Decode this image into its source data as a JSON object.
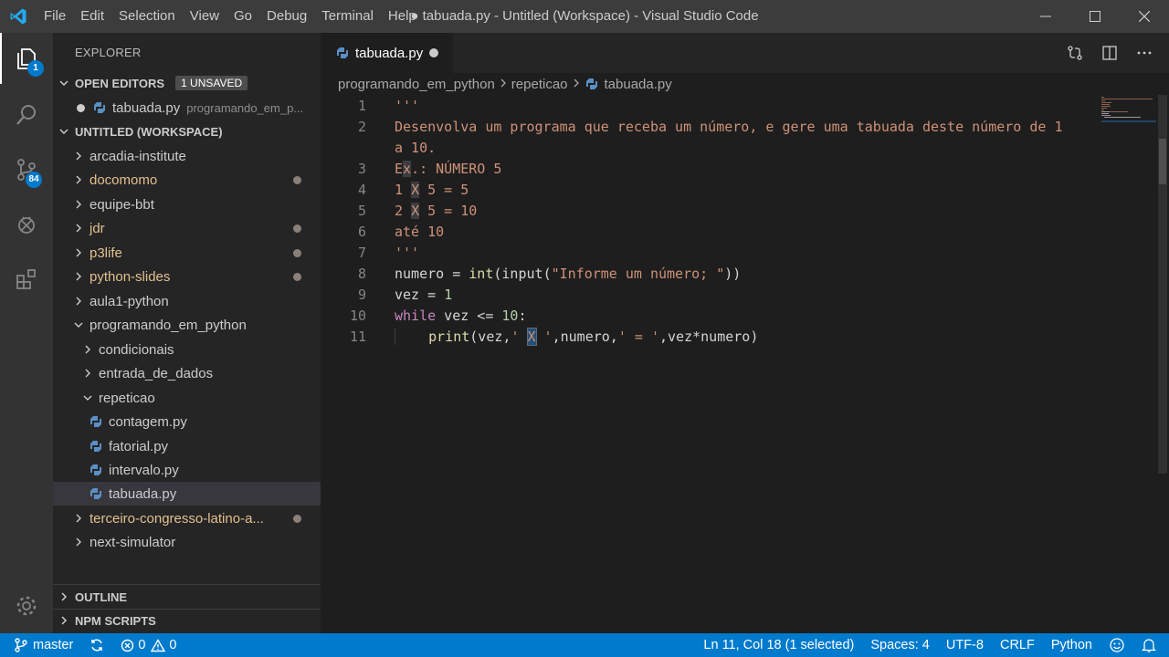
{
  "window": {
    "title": "● tabuada.py - Untitled (Workspace) - Visual Studio Code",
    "menu": [
      "File",
      "Edit",
      "Selection",
      "View",
      "Go",
      "Debug",
      "Terminal",
      "Help"
    ]
  },
  "activity": {
    "explorer_badge": "1",
    "scm_badge": "84"
  },
  "sidebar": {
    "title": "EXPLORER",
    "open_editors": {
      "label": "OPEN EDITORS",
      "badge": "1 UNSAVED",
      "file": "tabuada.py",
      "path": "programando_em_p..."
    },
    "workspace_label": "UNTITLED (WORKSPACE)",
    "tree": [
      {
        "label": "arcadia-institute"
      },
      {
        "label": "docomomo"
      },
      {
        "label": "equipe-bbt"
      },
      {
        "label": "jdr"
      },
      {
        "label": "p3life"
      },
      {
        "label": "python-slides"
      },
      {
        "label": "aula1-python"
      },
      {
        "label": "programando_em_python"
      },
      {
        "label": "condicionais"
      },
      {
        "label": "entrada_de_dados"
      },
      {
        "label": "repeticao"
      },
      {
        "label": "contagem.py"
      },
      {
        "label": "fatorial.py"
      },
      {
        "label": "intervalo.py"
      },
      {
        "label": "tabuada.py"
      },
      {
        "label": "terceiro-congresso-latino-a..."
      },
      {
        "label": "next-simulator"
      }
    ],
    "outline_label": "OUTLINE",
    "npm_label": "NPM SCRIPTS"
  },
  "editor": {
    "tab_label": "tabuada.py",
    "breadcrumb": [
      "programando_em_python",
      "repeticao",
      "tabuada.py"
    ],
    "line_numbers": [
      "1",
      "2",
      "",
      "3",
      "4",
      "5",
      "6",
      "7",
      "8",
      "9",
      "10",
      "11"
    ],
    "code": {
      "l1": "'''",
      "l2a": "Desenvolva um programa que receba um número, e gere uma tabuada deste número de 1",
      "l2b": "a 10.",
      "l3a": "E",
      "l3b": "x",
      "l3c": ".: NÚMERO 5",
      "l4a": "1 ",
      "l4b": "X",
      "l4c": " 5 = 5",
      "l5a": "2 ",
      "l5b": "X",
      "l5c": " 5 = 10",
      "l6": "até 10",
      "l7": "'''",
      "l8_var": "numero = ",
      "l8_int": "int",
      "l8_p1": "(",
      "l8_input": "input",
      "l8_p2": "(",
      "l8_str": "\"Informe um número; \"",
      "l8_p3": "))",
      "l9_var": "vez = ",
      "l9_num": "1",
      "l10_kw": "while",
      "l10_mid": " vez <= ",
      "l10_num": "10",
      "l10_end": ":",
      "l11_indent": "    ",
      "l11_fn": "print",
      "l11_a": "(vez,",
      "l11_s1a": "' ",
      "l11_sel": "X",
      "l11_s1b": " '",
      "l11_b": ",numero,",
      "l11_s2": "' = '",
      "l11_c": ",vez*numero)"
    }
  },
  "status": {
    "branch": "master",
    "errors": "0",
    "warnings": "0",
    "position": "Ln 11, Col 18 (1 selected)",
    "spaces": "Spaces: 4",
    "encoding": "UTF-8",
    "eol": "CRLF",
    "language": "Python"
  },
  "colors": {
    "accent": "#007acc",
    "string": "#ce9178",
    "keyword": "#c586c0",
    "function": "#dcdcaa",
    "number": "#b5cea8",
    "modified": "#e2c08d"
  }
}
